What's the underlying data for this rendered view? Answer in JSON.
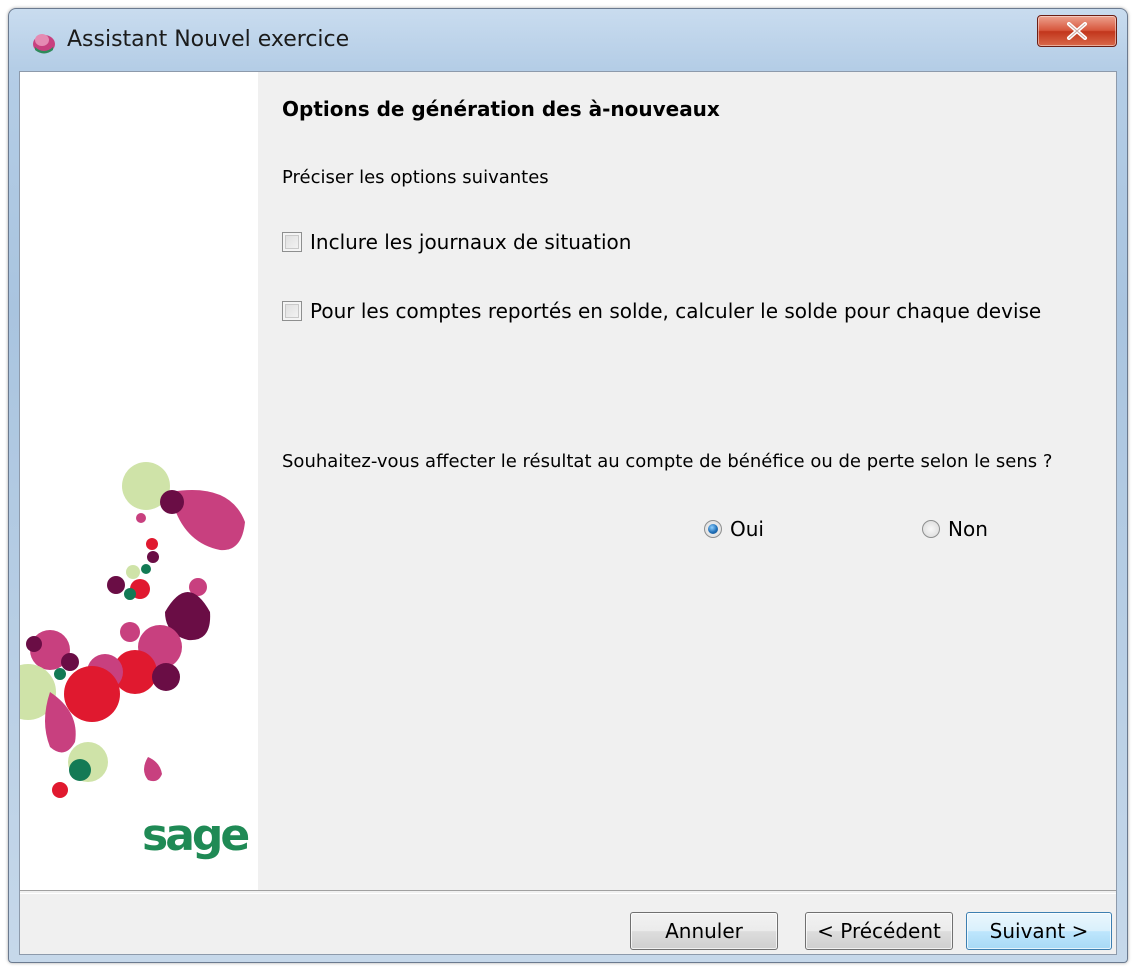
{
  "window": {
    "title": "Assistant Nouvel exercice",
    "close_icon": "close-icon"
  },
  "sidebar": {
    "logo_text": "sage"
  },
  "content": {
    "heading": "Options de génération des à-nouveaux",
    "instruction": "Préciser les options suivantes",
    "options": [
      {
        "label": "Inclure les journaux de situation",
        "checked": false
      },
      {
        "label": "Pour les comptes reportés en solde, calculer le solde pour chaque devise",
        "checked": false
      }
    ],
    "question": "Souhaitez-vous affecter le résultat au compte de bénéfice ou de perte selon le sens ?",
    "radio": {
      "yes_label": "Oui",
      "no_label": "Non",
      "selected": "Oui"
    }
  },
  "footer": {
    "cancel_label": "Annuler",
    "previous_label": "< Précédent",
    "next_label": "Suivant >"
  },
  "colors": {
    "logo_green": "#1f8a55",
    "close_red": "#c2361c",
    "art_pink": "#c8407f",
    "art_plum": "#6a0d45",
    "art_red": "#e0192f",
    "art_light_green": "#cfe3a8",
    "art_dark_green": "#137a55"
  }
}
